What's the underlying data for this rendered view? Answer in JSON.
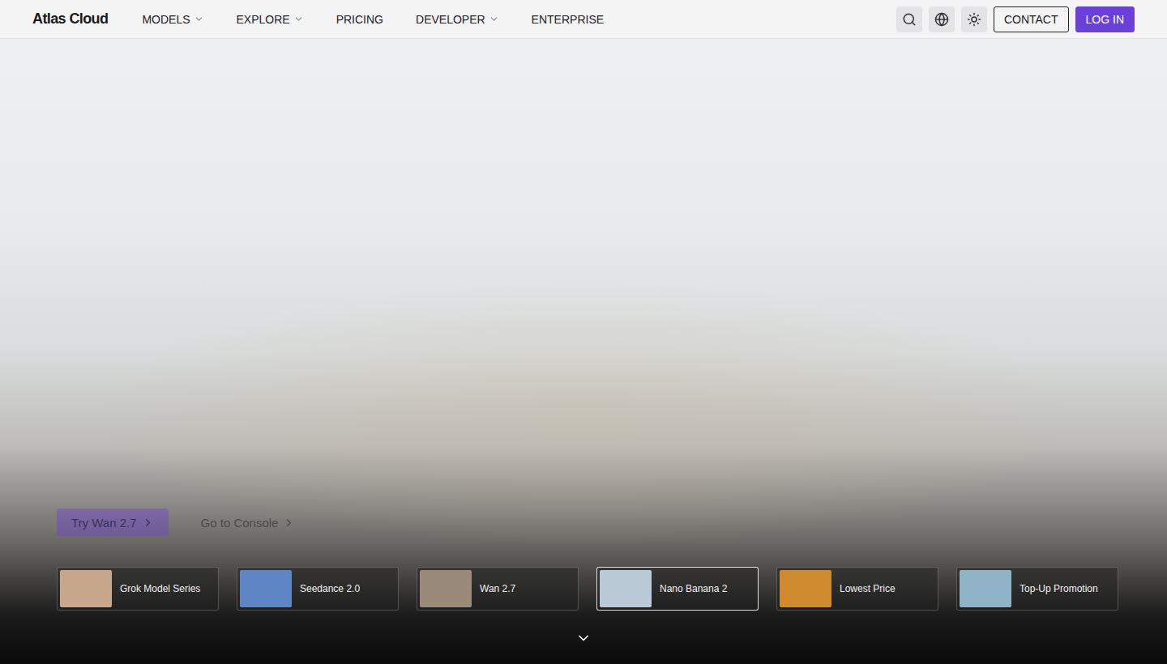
{
  "nav": {
    "logo": "Atlas Cloud",
    "menu": [
      {
        "label": "MODELS",
        "dropdown": true
      },
      {
        "label": "EXPLORE",
        "dropdown": true
      },
      {
        "label": "PRICING",
        "dropdown": false
      },
      {
        "label": "DEVELOPER",
        "dropdown": true
      },
      {
        "label": "ENTERPRISE",
        "dropdown": false
      }
    ],
    "contact": "CONTACT",
    "login": "LOG IN"
  },
  "hero": {
    "actions": [
      {
        "label": "Try Wan 2.7",
        "kind": "primary"
      },
      {
        "label": "Go to Console",
        "kind": "link"
      }
    ]
  },
  "cards": [
    {
      "label": "Grok Model Series",
      "selected": false,
      "color": "#c8a88c"
    },
    {
      "label": "Seedance 2.0",
      "selected": false,
      "color": "#5f86c4"
    },
    {
      "label": "Wan 2.7",
      "selected": false,
      "color": "#9a8a7a"
    },
    {
      "label": "Nano Banana 2",
      "selected": true,
      "color": "#b9c9d6"
    },
    {
      "label": "Lowest Price",
      "selected": false,
      "color": "#d08a2e"
    },
    {
      "label": "Top-Up Promotion",
      "selected": false,
      "color": "#8fb4c8"
    }
  ]
}
